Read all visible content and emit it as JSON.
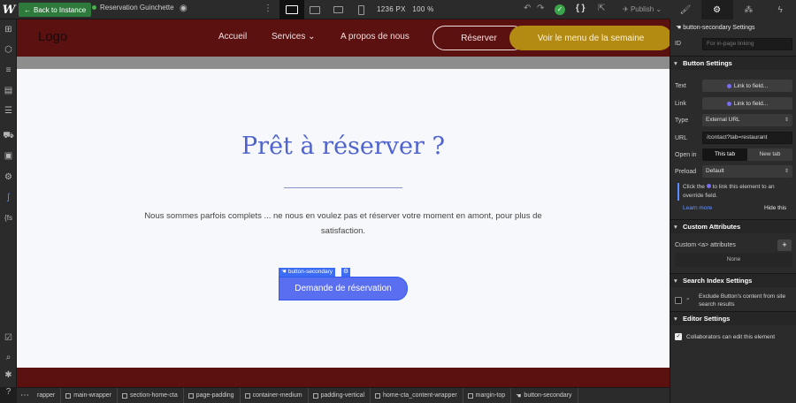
{
  "topbar": {
    "back_label": "Back to Instance",
    "site_name": "Reservation Guinchette",
    "viewport_width": "1236 PX",
    "zoom": "100 %",
    "publish_label": "Publish"
  },
  "canvas": {
    "nav": {
      "logo": "Logo",
      "links": [
        "Accueil",
        "Services",
        "A propos de nous"
      ],
      "cta_outline": "Réserver",
      "cta_fill": "Voir le menu de la semaine"
    },
    "heading": "Prêt à réserver ?",
    "paragraph": "Nous sommes parfois complets ... ne nous en voulez pas et réserver votre moment en amont, pour plus de satisfaction.",
    "selection_tag": "button-secondary",
    "cta_button": "Demande de réservation"
  },
  "panel": {
    "header": "button-secondary Settings",
    "id_label": "ID",
    "id_placeholder": "For in-page linking",
    "button_settings": {
      "title": "Button Settings",
      "text_label": "Text",
      "text_value": "Link to field...",
      "link_label": "Link",
      "link_value": "Link to field...",
      "type_label": "Type",
      "type_value": "External URL",
      "url_label": "URL",
      "url_value": "/contact?tab=restaurant",
      "open_in_label": "Open in",
      "open_in_options": [
        "This tab",
        "New tab"
      ],
      "preload_label": "Preload",
      "preload_value": "Default",
      "hint_before": "Click the",
      "hint_after": "to link this element to an override field.",
      "learn_more": "Learn more",
      "hide_this": "Hide this"
    },
    "custom_attributes": {
      "title": "Custom Attributes",
      "label": "Custom <a> attributes",
      "empty": "None"
    },
    "search_index": {
      "title": "Search Index Settings",
      "exclude_label": "Exclude Button's content from site search results"
    },
    "editor_settings": {
      "title": "Editor Settings",
      "collab_label": "Collaborators can edit this element"
    }
  },
  "breadcrumb": [
    "rapper",
    "main-wrapper",
    "section-home-cta",
    "page-padding",
    "container-medium",
    "padding-vertical",
    "home-cta_content-wrapper",
    "margin-top",
    "button-secondary"
  ],
  "colors": {
    "brand_maroon": "#5a1110",
    "gold": "#b38a12",
    "heading_blue": "#4e63cf",
    "cta_blue": "#5a6ef0",
    "editor_bg": "#2b2b2b",
    "webflow_blue": "#3b6cf3"
  }
}
